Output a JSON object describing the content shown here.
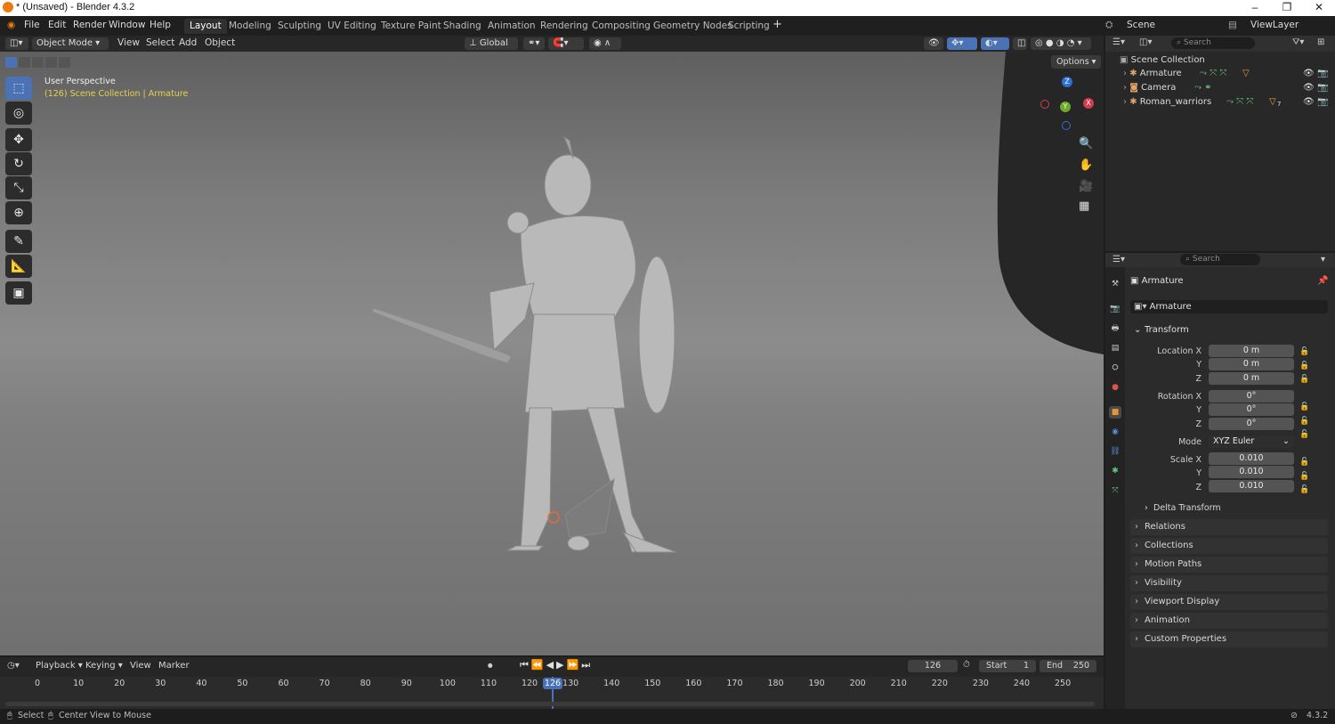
{
  "window": {
    "title": "* (Unsaved) - Blender 4.3.2",
    "buttons": [
      "–",
      "❐",
      "✕"
    ]
  },
  "menu": [
    "File",
    "Edit",
    "Render",
    "Window",
    "Help"
  ],
  "workspaces": [
    "Layout",
    "Modeling",
    "Sculpting",
    "UV Editing",
    "Texture Paint",
    "Shading",
    "Animation",
    "Rendering",
    "Compositing",
    "Geometry Nodes",
    "Scripting"
  ],
  "active_workspace": "Layout",
  "scene": "Scene",
  "view_layer": "ViewLayer",
  "viewport_header": {
    "mode": "Object Mode",
    "menus": [
      "View",
      "Select",
      "Add",
      "Object"
    ],
    "orientation": "Global",
    "options": "Options"
  },
  "viewport": {
    "perspective": "User Perspective",
    "context": "(126) Scene Collection | Armature",
    "gizmo_axes": {
      "x": "X",
      "y": "Y",
      "z": "Z"
    }
  },
  "outliner": {
    "search_placeholder": "Search",
    "root": "Scene Collection",
    "items": [
      {
        "name": "Armature"
      },
      {
        "name": "Camera"
      },
      {
        "name": "Roman_warriors",
        "badge": "7"
      }
    ]
  },
  "properties": {
    "search_placeholder": "Search",
    "object_name": "Armature",
    "datablock": "Armature",
    "transform_title": "Transform",
    "location": {
      "label": "Location X",
      "x": "0 m",
      "y": "0 m",
      "z": "0 m"
    },
    "rotation": {
      "label": "Rotation X",
      "x": "0°",
      "y": "0°",
      "z": "0°"
    },
    "mode_label": "Mode",
    "mode": "XYZ Euler",
    "scale": {
      "label": "Scale X",
      "x": "0.010",
      "y": "0.010",
      "z": "0.010"
    },
    "axis_y": "Y",
    "axis_z": "Z",
    "delta": "Delta Transform",
    "panels": [
      "Relations",
      "Collections",
      "Motion Paths",
      "Visibility",
      "Viewport Display",
      "Animation",
      "Custom Properties"
    ]
  },
  "timeline": {
    "menus": [
      "Playback",
      "Keying",
      "View",
      "Marker"
    ],
    "current_frame": "126",
    "start_label": "Start",
    "start": "1",
    "end_label": "End",
    "end": "250",
    "ticks": [
      "0",
      "10",
      "20",
      "30",
      "40",
      "50",
      "60",
      "70",
      "80",
      "90",
      "100",
      "110",
      "120",
      "130",
      "140",
      "150",
      "160",
      "170",
      "180",
      "190",
      "200",
      "210",
      "220",
      "230",
      "240",
      "250"
    ]
  },
  "status": {
    "select": "Select",
    "center": "Center View to Mouse",
    "version": "4.3.2"
  },
  "colors": {
    "accent": "#4b72b5",
    "frame_marker": "#4772b3",
    "context_text": "#e6d44a"
  }
}
